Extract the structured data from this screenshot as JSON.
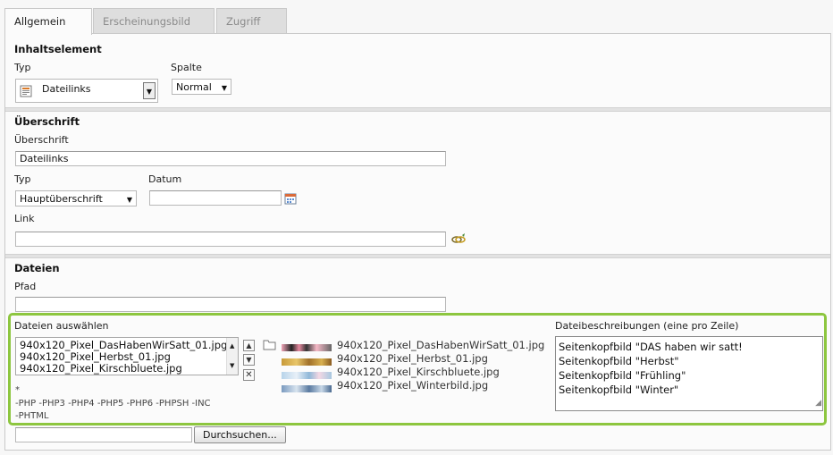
{
  "tabs": [
    "Allgemein",
    "Erscheinungsbild",
    "Zugriff"
  ],
  "section_content": {
    "title": "Inhaltselement",
    "type_label": "Typ",
    "type_value": "Dateilinks",
    "column_label": "Spalte",
    "column_value": "Normal"
  },
  "section_header": {
    "title": "Überschrift",
    "header_label": "Überschrift",
    "header_value": "Dateilinks",
    "type_label": "Typ",
    "type_value": "Hauptüberschrift",
    "date_label": "Datum",
    "date_value": "",
    "link_label": "Link",
    "link_value": ""
  },
  "section_files": {
    "title": "Dateien",
    "path_label": "Pfad",
    "path_value": "",
    "select_label": "Dateien auswählen",
    "selected_files": [
      "940x120_Pixel_DasHabenWirSatt_01.jpg",
      "940x120_Pixel_Herbst_01.jpg",
      "940x120_Pixel_Kirschbluete.jpg"
    ],
    "thumbnail_files": [
      "940x120_Pixel_DasHabenWirSatt_01.jpg",
      "940x120_Pixel_Herbst_01.jpg",
      "940x120_Pixel_Kirschbluete.jpg",
      "940x120_Pixel_Winterbild.jpg"
    ],
    "allowed_prefix": "*",
    "disallowed_line1": "-PHP -PHP3 -PHP4 -PHP5 -PHP6 -PHPSH -INC",
    "disallowed_line2": "-PHTML",
    "browse_button": "Durchsuchen...",
    "descriptions_label": "Dateibeschreibungen (eine pro Zeile)",
    "descriptions": [
      "Seitenkopfbild \"DAS haben wir satt!",
      "Seitenkopfbild \"Herbst\"",
      "Seitenkopfbild \"Frühling\"",
      "Seitenkopfbild \"Winter\""
    ]
  },
  "colors": {
    "highlight_border": "#8dc63f",
    "panel_bg": "#fbfbfb",
    "tab_inactive_bg": "#dedede"
  }
}
